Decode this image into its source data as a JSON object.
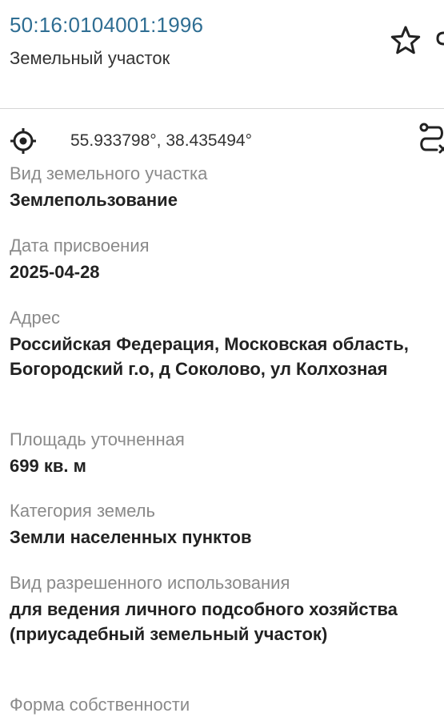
{
  "header": {
    "cadastral_number": "50:16:0104001:1996",
    "object_type": "Земельный участок",
    "favorite_icon": "star-outline-icon",
    "edge_icon": "partial-icon"
  },
  "location": {
    "icon": "target-icon",
    "coordinates": "55.933798°, 38.435494°",
    "route_icon": "route-icon"
  },
  "fields": [
    {
      "label": "Вид земельного участка",
      "value": "Землепользование"
    },
    {
      "label": "Дата присвоения",
      "value": "2025-04-28"
    },
    {
      "label": "Адрес",
      "value": "Российская Федерация, Московская область, Богородский г.о, д Соколово, ул Колхозная"
    },
    {
      "label": "Площадь уточненная",
      "value": "699 кв. м"
    },
    {
      "label": "Категория земель",
      "value": "Земли населенных пунктов"
    },
    {
      "label": "Вид разрешенного использования",
      "value": "для ведения личного подсобного хозяйства (приусадебный земельный участок)"
    },
    {
      "label": "Форма собственности",
      "value": ""
    }
  ],
  "colors": {
    "link": "#2f6e93",
    "label": "#8a8a8a",
    "value": "#222222",
    "divider": "#d6d6d6"
  }
}
